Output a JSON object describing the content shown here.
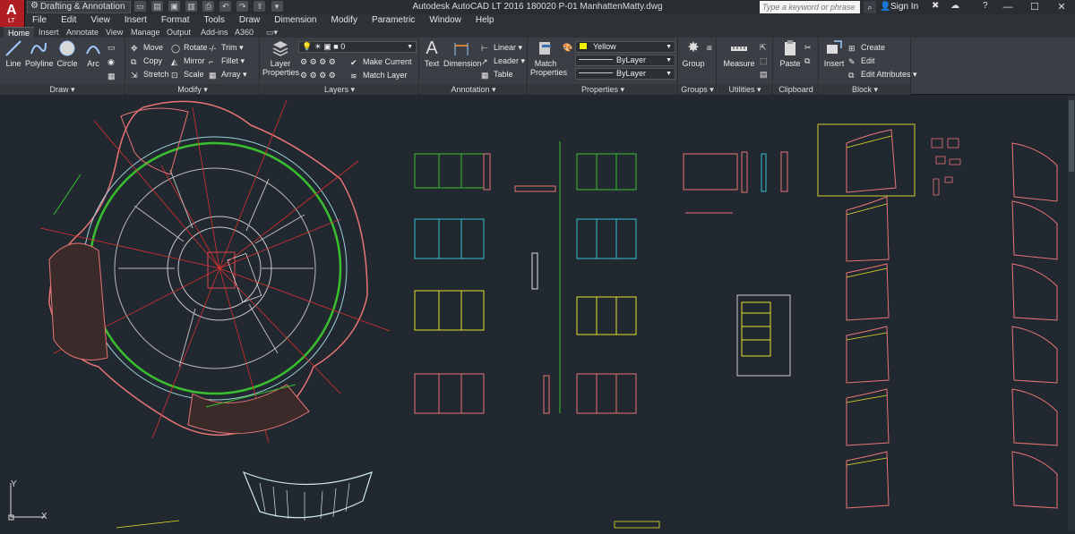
{
  "titlebar": {
    "app_letter": "A",
    "app_edition": "LT",
    "workspace": "Drafting & Annotation",
    "title": "Autodesk AutoCAD LT 2016    180020 P-01 ManhattenMatty.dwg",
    "search_placeholder": "Type a keyword or phrase",
    "signin": "Sign In",
    "help": "?",
    "minimize": "—",
    "maximize": "☐",
    "close": "✕"
  },
  "menubar": [
    "File",
    "Edit",
    "View",
    "Insert",
    "Format",
    "Tools",
    "Draw",
    "Dimension",
    "Modify",
    "Parametric",
    "Window",
    "Help"
  ],
  "ribbon_tabs": [
    "Home",
    "Insert",
    "Annotate",
    "View",
    "Manage",
    "Output",
    "Add-ins",
    "A360"
  ],
  "ribbon": {
    "draw": {
      "title": "Draw",
      "line": "Line",
      "polyline": "Polyline",
      "circle": "Circle",
      "arc": "Arc"
    },
    "modify": {
      "title": "Modify",
      "move": "Move",
      "rotate": "Rotate",
      "trim": "Trim",
      "copy": "Copy",
      "mirror": "Mirror",
      "fillet": "Fillet",
      "stretch": "Stretch",
      "scale": "Scale",
      "array": "Array"
    },
    "layers": {
      "title": "Layers",
      "layer_properties_1": "Layer",
      "layer_properties_2": "Properties",
      "current_layer": "0",
      "make_current": "Make Current",
      "match_layer": "Match Layer"
    },
    "annotation": {
      "title": "Annotation",
      "text": "Text",
      "dimension": "Dimension",
      "linear": "Linear",
      "leader": "Leader",
      "table": "Table"
    },
    "properties": {
      "title": "Properties",
      "match_1": "Match",
      "match_2": "Properties",
      "color": "Yellow",
      "linetype": "ByLayer",
      "lineweight": "ByLayer",
      "color_hex": "#f2f200"
    },
    "groups": {
      "title": "Groups",
      "group": "Group"
    },
    "utilities": {
      "title": "Utilities",
      "measure": "Measure"
    },
    "clipboard": {
      "title": "Clipboard",
      "paste": "Paste"
    },
    "block": {
      "title": "Block",
      "insert": "Insert",
      "create": "Create",
      "edit": "Edit",
      "edit_attributes": "Edit Attributes"
    }
  },
  "canvas": {
    "ucs_y": "Y",
    "ucs_x": "X",
    "background": "#212830"
  }
}
